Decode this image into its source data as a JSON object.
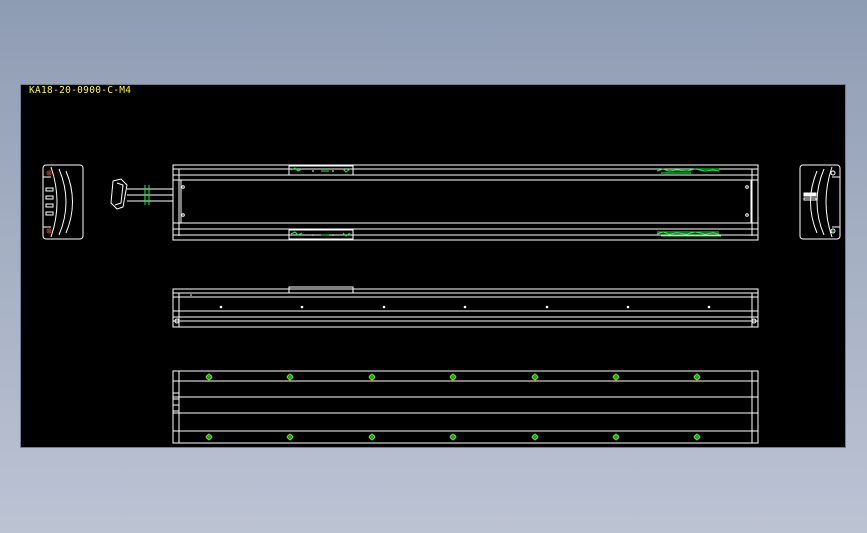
{
  "drawing": {
    "title": "KA18-20-0900-C-M4"
  },
  "colors": {
    "background_outer": "#8e9cb3",
    "canvas": "#000000",
    "line": "#ffffff",
    "title_text": "#ffff00",
    "green_detail": "#00ff33",
    "yellow_marker": "#ffff00",
    "red_marker": "#ff2020"
  },
  "icons": [
    "end-cap-left-icon",
    "end-cap-right-icon",
    "motor-cable-icon"
  ]
}
